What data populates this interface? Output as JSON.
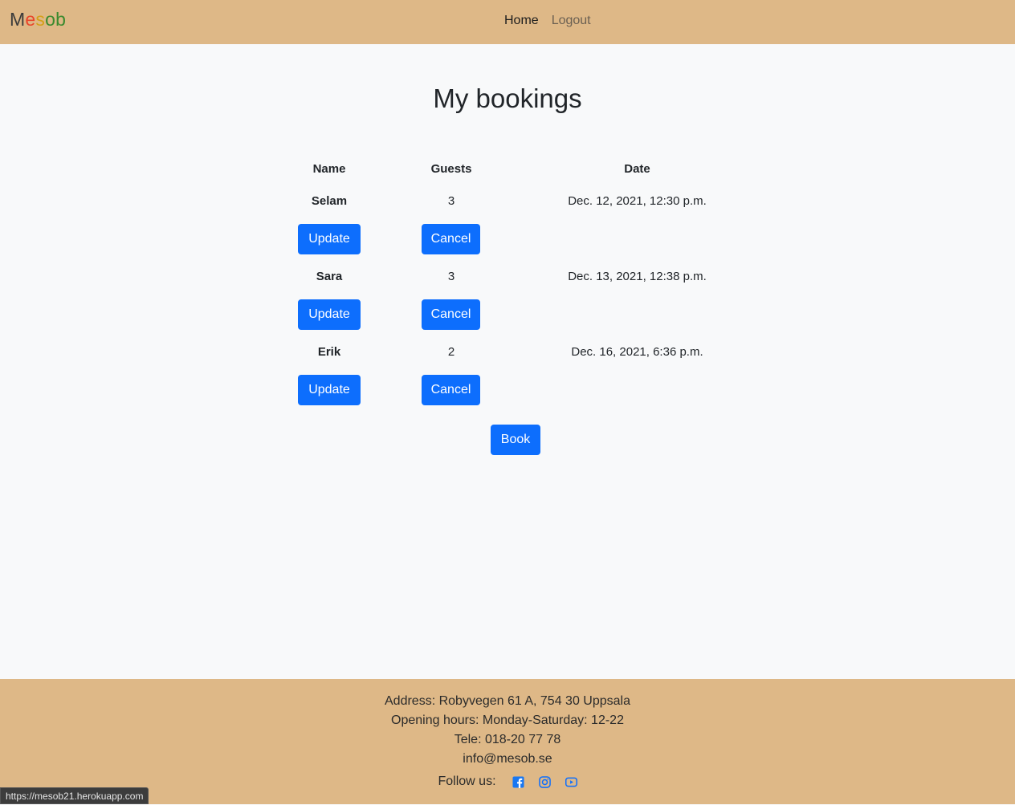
{
  "nav": {
    "brand_letters": [
      "M",
      "e",
      "s",
      "o"
    ],
    "brand_last": "b",
    "home_label": "Home",
    "logout_label": "Logout"
  },
  "main": {
    "title": "My bookings",
    "columns": {
      "name": "Name",
      "guests": "Guests",
      "date": "Date"
    },
    "bookings": [
      {
        "name": "Selam",
        "guests": "3",
        "date": "Dec. 12, 2021, 12:30 p.m.",
        "update_label": "Update",
        "cancel_label": "Cancel"
      },
      {
        "name": "Sara",
        "guests": "3",
        "date": "Dec. 13, 2021, 12:38 p.m.",
        "update_label": "Update",
        "cancel_label": "Cancel"
      },
      {
        "name": "Erik",
        "guests": "2",
        "date": "Dec. 16, 2021, 6:36 p.m.",
        "update_label": "Update",
        "cancel_label": "Cancel"
      }
    ],
    "book_label": "Book"
  },
  "footer": {
    "address": "Address: Robyvegen 61 A, 754 30 Uppsala",
    "hours": "Opening hours: Monday-Saturday: 12-22",
    "phone": "Tele: 018-20 77 78",
    "email": "info@mesob.se",
    "follow_label": "Follow us:",
    "social_icons": [
      "facebook-icon",
      "instagram-icon",
      "youtube-icon"
    ]
  },
  "status_bar": {
    "url": "https://mesob21.herokuapp.com"
  },
  "colors": {
    "header_footer_bg": "#deb887",
    "primary_button": "#0d6efd",
    "page_bg": "#f8f9fa"
  }
}
